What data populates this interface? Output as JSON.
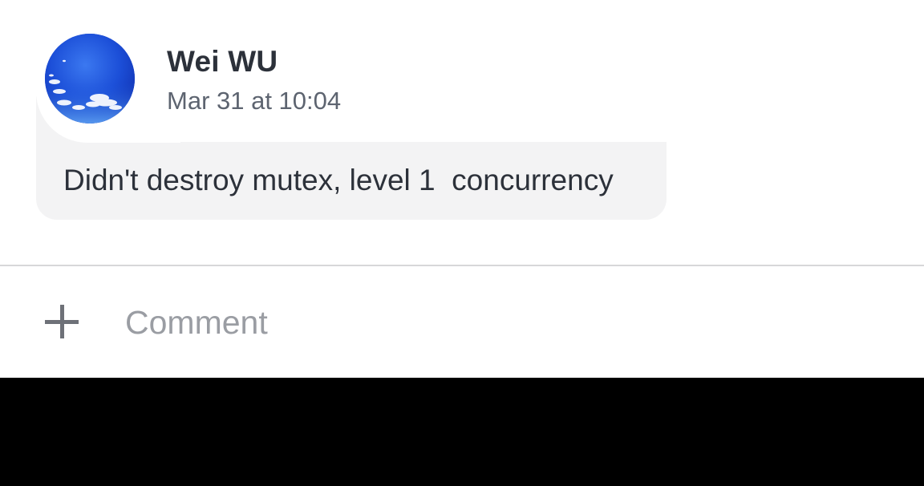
{
  "comment": {
    "author": "Wei WU",
    "timestamp": "Mar 31 at 10:04",
    "text": "Didn't destroy mutex, level 1  concurrency",
    "avatar": "sky-avatar"
  },
  "composer": {
    "add_icon": "plus-icon",
    "placeholder": "Comment"
  },
  "colors": {
    "bubble": "#f3f3f4",
    "text": "#2c313a",
    "secondary_text": "#5d6470",
    "placeholder": "#9a9da3",
    "divider": "#d7d7d9",
    "bottom_bar": "#000000"
  }
}
